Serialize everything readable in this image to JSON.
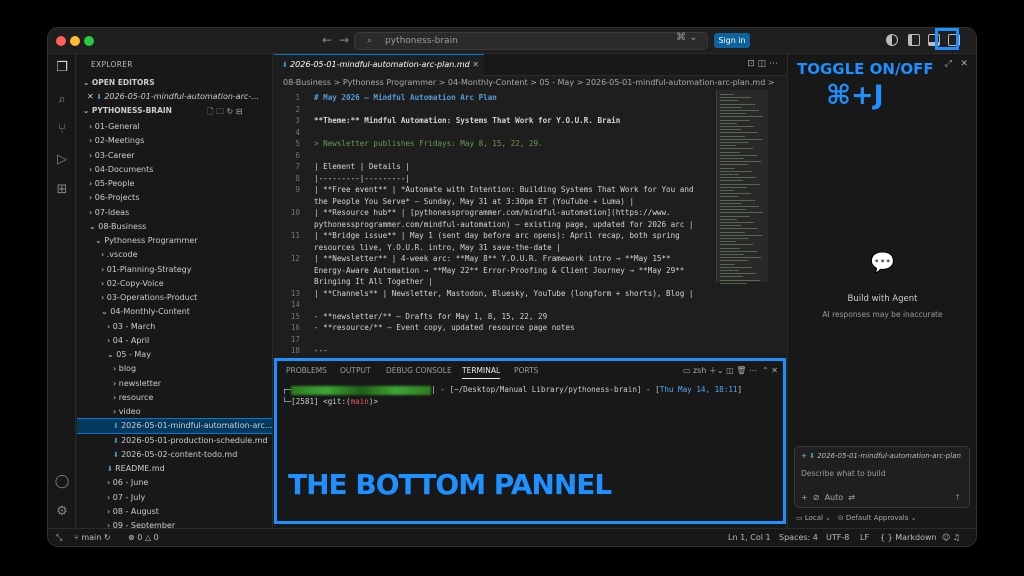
{
  "titlebar": {
    "command_center": "pythoness-brain",
    "sign_in": "Sign in"
  },
  "sidebar": {
    "title": "EXPLORER",
    "open_editors_label": "OPEN EDITORS",
    "open_editor_file": "2026-05-01-mindful-automation-arc-...",
    "workspace_label": "PYTHONESS-BRAIN",
    "tree": [
      {
        "label": "01-General",
        "indent": 0,
        "arrow": ">"
      },
      {
        "label": "02-Meetings",
        "indent": 0,
        "arrow": ">"
      },
      {
        "label": "03-Career",
        "indent": 0,
        "arrow": ">"
      },
      {
        "label": "04-Documents",
        "indent": 0,
        "arrow": ">"
      },
      {
        "label": "05-People",
        "indent": 0,
        "arrow": ">"
      },
      {
        "label": "06-Projects",
        "indent": 0,
        "arrow": ">"
      },
      {
        "label": "07-Ideas",
        "indent": 0,
        "arrow": ">"
      },
      {
        "label": "08-Business",
        "indent": 0,
        "arrow": "v"
      },
      {
        "label": "Pythoness Programmer",
        "indent": 1,
        "arrow": "v"
      },
      {
        "label": ".vscode",
        "indent": 2,
        "arrow": ">"
      },
      {
        "label": "01-Planning-Strategy",
        "indent": 2,
        "arrow": ">"
      },
      {
        "label": "02-Copy-Voice",
        "indent": 2,
        "arrow": ">"
      },
      {
        "label": "03-Operations-Product",
        "indent": 2,
        "arrow": ">"
      },
      {
        "label": "04-Monthly-Content",
        "indent": 2,
        "arrow": "v"
      },
      {
        "label": "03 - March",
        "indent": 3,
        "arrow": ">"
      },
      {
        "label": "04 - April",
        "indent": 3,
        "arrow": ">"
      },
      {
        "label": "05 - May",
        "indent": 3,
        "arrow": "v"
      },
      {
        "label": "blog",
        "indent": 4,
        "arrow": ">"
      },
      {
        "label": "newsletter",
        "indent": 4,
        "arrow": ">"
      },
      {
        "label": "resource",
        "indent": 4,
        "arrow": ">"
      },
      {
        "label": "video",
        "indent": 4,
        "arrow": ">"
      },
      {
        "label": "2026-05-01-mindful-automation-arc...",
        "indent": 4,
        "arrow": "",
        "md": true,
        "selected": true
      },
      {
        "label": "2026-05-01-production-schedule.md",
        "indent": 4,
        "arrow": "",
        "md": true
      },
      {
        "label": "2026-05-02-content-todo.md",
        "indent": 4,
        "arrow": "",
        "md": true
      },
      {
        "label": "README.md",
        "indent": 3,
        "arrow": "",
        "md": true
      },
      {
        "label": "06 - June",
        "indent": 3,
        "arrow": ">"
      },
      {
        "label": "07 - July",
        "indent": 3,
        "arrow": ">"
      },
      {
        "label": "08 - August",
        "indent": 3,
        "arrow": ">"
      },
      {
        "label": "09 - September",
        "indent": 3,
        "arrow": ">"
      }
    ]
  },
  "editor": {
    "tab_label": "2026-05-01-mindful-automation-arc-plan.md",
    "breadcrumb": "08-Business > Pythoness Programmer > 04-Monthly-Content > 05 - May > 2026-05-01-mindful-automation-arc-plan.md >",
    "lines": [
      {
        "n": "1",
        "text": "# May 2026 — Mindful Automation Arc Plan",
        "style": "heading"
      },
      {
        "n": "2",
        "text": ""
      },
      {
        "n": "3",
        "text": "**Theme:** Mindful Automation: Systems That Work for Y.O.U.R. Brain",
        "style": "bold"
      },
      {
        "n": "4",
        "text": ""
      },
      {
        "n": "5",
        "text": "> Newsletter publishes Fridays: May 8, 15, 22, 29.",
        "style": "quote"
      },
      {
        "n": "6",
        "text": ""
      },
      {
        "n": "7",
        "text": "| Element | Details |"
      },
      {
        "n": "8",
        "text": "|---------|---------|"
      },
      {
        "n": "9",
        "text": "| **Free event** | *Automate with Intention: Building Systems That Work for You and"
      },
      {
        "n": "",
        "text": "the People You Serve* — Sunday, May 31 at 3:30pm ET (YouTube + Luma) |"
      },
      {
        "n": "10",
        "text": "| **Resource hub** | [pythonessprogrammer.com/mindful-automation](https://www."
      },
      {
        "n": "",
        "text": "pythonessprogrammer.com/mindful-automation) — existing page, updated for 2026 arc |"
      },
      {
        "n": "11",
        "text": "| **Bridge issue** | May 1 (sent day before arc opens): April recap, both spring"
      },
      {
        "n": "",
        "text": "resources live, Y.O.U.R. intro, May 31 save-the-date |"
      },
      {
        "n": "12",
        "text": "| **Newsletter** | 4-week arc: **May 8** Y.O.U.R. Framework intro → **May 15**"
      },
      {
        "n": "",
        "text": "Energy-Aware Automation → **May 22** Error-Proofing & Client Journey → **May 29**"
      },
      {
        "n": "",
        "text": "Bringing It All Together |"
      },
      {
        "n": "13",
        "text": "| **Channels** | Newsletter, Mastodon, Bluesky, YouTube (longform + shorts), Blog |"
      },
      {
        "n": "14",
        "text": ""
      },
      {
        "n": "15",
        "text": "- **newsletter/** — Drafts for May 1, 8, 15, 22, 29",
        "style": "list"
      },
      {
        "n": "16",
        "text": "- **resource/** — Event copy, updated resource page notes",
        "style": "list"
      },
      {
        "n": "17",
        "text": ""
      },
      {
        "n": "18",
        "text": "---"
      }
    ]
  },
  "panel": {
    "tabs": [
      "PROBLEMS",
      "OUTPUT",
      "DEBUG CONSOLE",
      "TERMINAL",
      "PORTS"
    ],
    "active_tab": "TERMINAL",
    "shell": "zsh",
    "term_line1_path": "| - [~/Desktop/Manual Library/pythoness-brain] - [",
    "term_line1_date": "Thu May 14, 18:11",
    "term_line1_end": "]",
    "term_line2_a": "[2581] <git:(",
    "term_line2_branch": "main",
    "term_line2_b": ")>"
  },
  "chat": {
    "title": "Build with Agent",
    "subtitle": "AI responses may be inaccurate",
    "attachment": "2026-05-01-mindful-automation-arc-plan",
    "placeholder": "Describe what to build",
    "mode": "Auto",
    "local": "Local",
    "approvals": "Default Approvals"
  },
  "statusbar": {
    "branch": "main",
    "errors": "0",
    "warnings": "0",
    "position": "Ln 1, Col 1",
    "spaces": "Spaces: 4",
    "encoding": "UTF-8",
    "eol": "LF",
    "language": "Markdown"
  },
  "annotations": {
    "toggle_title": "TOGGLE ON/OFF",
    "toggle_shortcut": "⌘+J",
    "panel_label": "THE BOTTOM PANNEL",
    "accent": "#1e90ff"
  }
}
